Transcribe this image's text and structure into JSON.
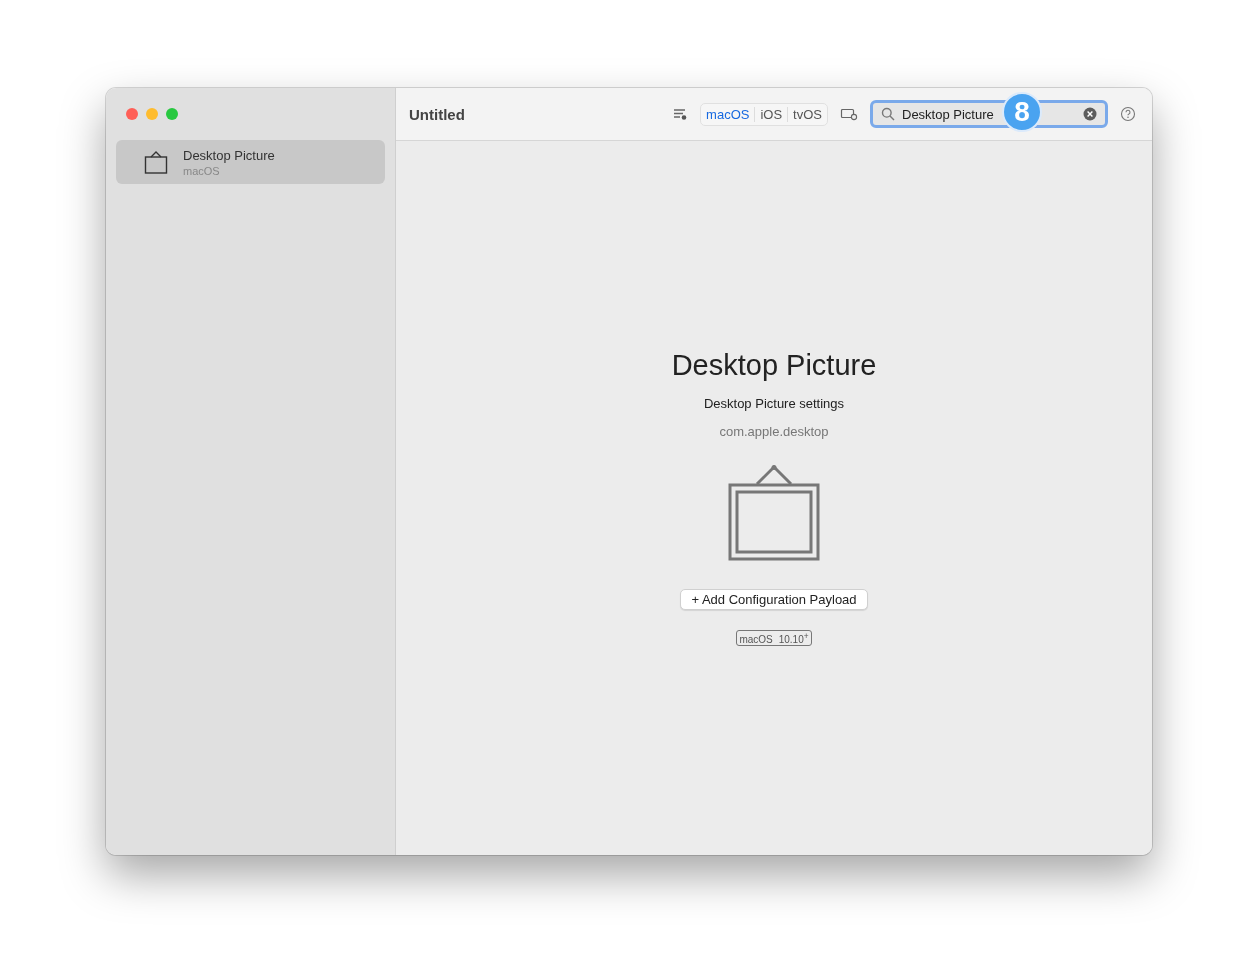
{
  "window": {
    "title": "Untitled"
  },
  "sidebar": {
    "items": [
      {
        "title": "Desktop Picture",
        "subtitle": "macOS",
        "selected": true
      }
    ]
  },
  "toolbar": {
    "platforms": [
      {
        "label": "macOS",
        "selected": true
      },
      {
        "label": "iOS",
        "selected": false
      },
      {
        "label": "tvOS",
        "selected": false
      }
    ],
    "search": {
      "value": "Desktop Picture"
    },
    "step_badge": "8"
  },
  "content": {
    "title": "Desktop Picture",
    "subtitle": "Desktop Picture settings",
    "identifier": "com.apple.desktop",
    "add_button": {
      "icon": "+",
      "label": "Add Configuration Payload"
    },
    "requirement": {
      "platform": "macOS",
      "version": "10.10$^{+}$"
    }
  }
}
